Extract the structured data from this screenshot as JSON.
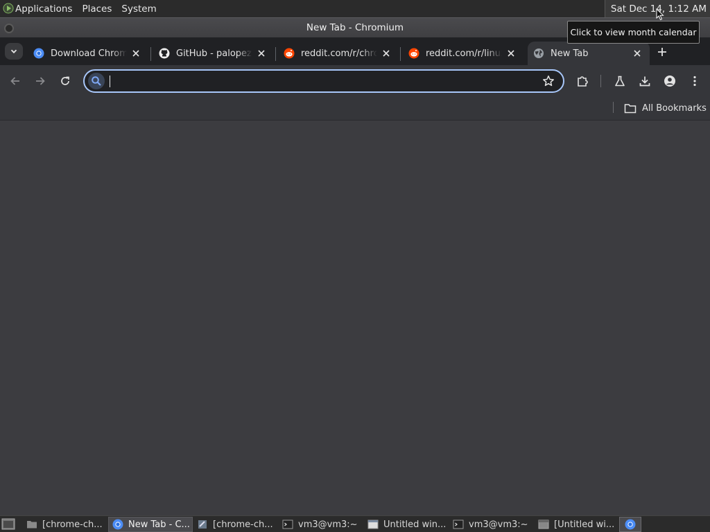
{
  "top_panel": {
    "menus": [
      "Applications",
      "Places",
      "System"
    ],
    "clock": "Sat Dec 14,  1:12 AM"
  },
  "tooltip": "Click to view month calendar",
  "window": {
    "title": "New Tab - Chromium"
  },
  "tabs": [
    {
      "label": "Download Chromium",
      "favicon": "chromium-icon",
      "active": false
    },
    {
      "label": "GitHub - palopezv/",
      "favicon": "github-icon",
      "active": false
    },
    {
      "label": "reddit.com/r/chromium",
      "favicon": "reddit-icon",
      "active": false
    },
    {
      "label": "reddit.com/r/linux",
      "favicon": "reddit-icon",
      "active": false
    },
    {
      "label": "New Tab",
      "favicon": "globe-icon",
      "active": true
    }
  ],
  "omnibox": {
    "value": "",
    "placeholder": ""
  },
  "bookmarks": {
    "all_label": "All Bookmarks"
  },
  "taskbar": {
    "items": [
      {
        "label": "[chrome-ch...",
        "icon": "folder-icon",
        "active": false
      },
      {
        "label": "New Tab - C...",
        "icon": "chromium-icon",
        "active": true
      },
      {
        "label": "[chrome-ch...",
        "icon": "editor-icon",
        "active": false
      },
      {
        "label": "vm3@vm3:~",
        "icon": "terminal-icon",
        "active": false
      },
      {
        "label": "Untitled win...",
        "icon": "window-icon",
        "active": false
      },
      {
        "label": "vm3@vm3:~",
        "icon": "terminal-icon",
        "active": false
      },
      {
        "label": "[Untitled wi...",
        "icon": "window-icon",
        "active": false
      }
    ]
  },
  "colors": {
    "accent": "#a8c7fa",
    "tabstrip": "#202124",
    "toolbar": "#35363a",
    "content": "#3c3c40"
  }
}
